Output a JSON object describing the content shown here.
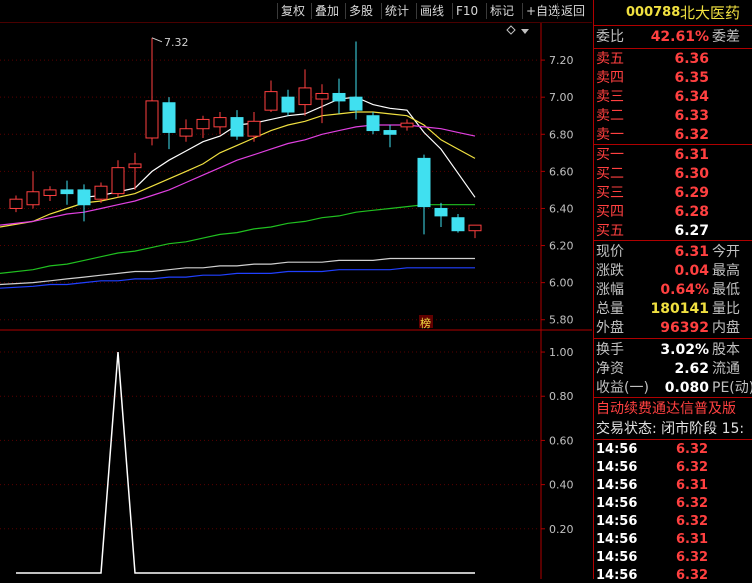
{
  "toolbar": {
    "buttons": [
      "复权",
      "叠加",
      "多股",
      "统计",
      "画线",
      "F10",
      "标记",
      "+自选",
      "返回"
    ]
  },
  "stock": {
    "code": "000788",
    "name": "北大医药"
  },
  "quote": {
    "weibi_label": "委比",
    "weibi_value": "42.61%",
    "weicha_label": "委差",
    "sell": [
      {
        "label": "卖五",
        "price": "6.36"
      },
      {
        "label": "卖四",
        "price": "6.35"
      },
      {
        "label": "卖三",
        "price": "6.34"
      },
      {
        "label": "卖二",
        "price": "6.33"
      },
      {
        "label": "卖一",
        "price": "6.32"
      }
    ],
    "buy": [
      {
        "label": "买一",
        "price": "6.31"
      },
      {
        "label": "买二",
        "price": "6.30"
      },
      {
        "label": "买三",
        "price": "6.29"
      },
      {
        "label": "买四",
        "price": "6.28"
      },
      {
        "label": "买五",
        "price": "6.27"
      }
    ],
    "stats": [
      {
        "label": "现价",
        "value": "6.31",
        "label2": "今开",
        "color": "red"
      },
      {
        "label": "涨跌",
        "value": "0.04",
        "label2": "最高",
        "color": "red"
      },
      {
        "label": "涨幅",
        "value": "0.64%",
        "label2": "最低",
        "color": "red"
      },
      {
        "label": "总量",
        "value": "180141",
        "label2": "量比",
        "color": "yellow"
      },
      {
        "label": "外盘",
        "value": "96392",
        "label2": "内盘",
        "color": "red"
      }
    ],
    "stats2": [
      {
        "label": "换手",
        "value": "3.02%",
        "label2": "股本",
        "color": "white"
      },
      {
        "label": "净资",
        "value": "2.62",
        "label2": "流通",
        "color": "white"
      },
      {
        "label": "收益(一)",
        "value": "0.080",
        "label2": "PE(动)",
        "color": "white"
      }
    ],
    "notice": "自动续费通达信普及版",
    "trade_status": "交易状态: 闭市阶段 15:",
    "ticks": [
      {
        "time": "14:56",
        "price": "6.32"
      },
      {
        "time": "14:56",
        "price": "6.32"
      },
      {
        "time": "14:56",
        "price": "6.31"
      },
      {
        "time": "14:56",
        "price": "6.32"
      },
      {
        "time": "14:56",
        "price": "6.32"
      },
      {
        "time": "14:56",
        "price": "6.31"
      },
      {
        "time": "14:56",
        "price": "6.32"
      },
      {
        "time": "14:56",
        "price": "6.32"
      }
    ]
  },
  "chart_data": [
    {
      "type": "candlestick",
      "y_ticks": [
        "7.20",
        "7.00",
        "6.80",
        "6.60",
        "6.40",
        "6.20",
        "6.00",
        "5.80"
      ],
      "ylim": [
        5.75,
        7.4
      ],
      "high_marker": "7.32",
      "bang_label": "榜",
      "candles": [
        {
          "o": 6.4,
          "c": 6.45,
          "h": 6.47,
          "l": 6.38
        },
        {
          "o": 6.42,
          "c": 6.49,
          "h": 6.6,
          "l": 6.4
        },
        {
          "o": 6.47,
          "c": 6.5,
          "h": 6.52,
          "l": 6.44
        },
        {
          "o": 6.5,
          "c": 6.48,
          "h": 6.55,
          "l": 6.42
        },
        {
          "o": 6.5,
          "c": 6.42,
          "h": 6.53,
          "l": 6.33
        },
        {
          "o": 6.45,
          "c": 6.52,
          "h": 6.54,
          "l": 6.43
        },
        {
          "o": 6.48,
          "c": 6.62,
          "h": 6.66,
          "l": 6.46
        },
        {
          "o": 6.62,
          "c": 6.64,
          "h": 6.7,
          "l": 6.5
        },
        {
          "o": 6.78,
          "c": 6.98,
          "h": 7.32,
          "l": 6.74
        },
        {
          "o": 6.97,
          "c": 6.81,
          "h": 7.0,
          "l": 6.72
        },
        {
          "o": 6.79,
          "c": 6.83,
          "h": 6.88,
          "l": 6.76
        },
        {
          "o": 6.83,
          "c": 6.88,
          "h": 6.9,
          "l": 6.78
        },
        {
          "o": 6.84,
          "c": 6.89,
          "h": 6.92,
          "l": 6.8
        },
        {
          "o": 6.89,
          "c": 6.79,
          "h": 6.93,
          "l": 6.77
        },
        {
          "o": 6.79,
          "c": 6.87,
          "h": 6.92,
          "l": 6.76
        },
        {
          "o": 6.93,
          "c": 7.03,
          "h": 7.09,
          "l": 6.92
        },
        {
          "o": 7.0,
          "c": 6.92,
          "h": 7.04,
          "l": 6.9
        },
        {
          "o": 6.96,
          "c": 7.05,
          "h": 7.15,
          "l": 6.9
        },
        {
          "o": 6.99,
          "c": 7.02,
          "h": 7.07,
          "l": 6.86
        },
        {
          "o": 7.02,
          "c": 6.98,
          "h": 7.1,
          "l": 6.91
        },
        {
          "o": 7.0,
          "c": 6.93,
          "h": 7.3,
          "l": 6.88
        },
        {
          "o": 6.9,
          "c": 6.82,
          "h": 6.92,
          "l": 6.8
        },
        {
          "o": 6.82,
          "c": 6.8,
          "h": 6.85,
          "l": 6.73
        },
        {
          "o": 6.84,
          "c": 6.86,
          "h": 6.88,
          "l": 6.82
        },
        {
          "o": 6.67,
          "c": 6.41,
          "h": 6.69,
          "l": 6.26
        },
        {
          "o": 6.4,
          "c": 6.36,
          "h": 6.43,
          "l": 6.3
        },
        {
          "o": 6.35,
          "c": 6.28,
          "h": 6.37,
          "l": 6.27
        },
        {
          "o": 6.28,
          "c": 6.31,
          "h": 6.31,
          "l": 6.24
        }
      ],
      "ma_lines": [
        {
          "color": "#ffffff",
          "values": [
            null,
            null,
            null,
            null,
            6.46,
            6.47,
            6.49,
            6.51,
            6.6,
            6.66,
            6.71,
            6.76,
            6.79,
            6.85,
            6.86,
            6.88,
            6.9,
            6.91,
            6.95,
            6.99,
            7.0,
            6.96,
            6.94,
            6.93,
            6.81,
            6.72,
            6.59,
            6.46
          ]
        },
        {
          "color": "#f0e040",
          "values": [
            6.3,
            6.33,
            6.37,
            6.4,
            6.43,
            6.44,
            6.46,
            6.48,
            6.52,
            6.56,
            6.6,
            6.64,
            6.7,
            6.74,
            6.78,
            6.82,
            6.85,
            6.87,
            6.9,
            6.91,
            6.92,
            6.92,
            6.91,
            6.9,
            6.85,
            6.77,
            6.72,
            6.67
          ]
        },
        {
          "color": "#e040e0",
          "values": [
            6.31,
            6.33,
            6.35,
            6.37,
            6.38,
            6.4,
            6.42,
            6.44,
            6.47,
            6.5,
            6.54,
            6.58,
            6.62,
            6.66,
            6.69,
            6.72,
            6.75,
            6.77,
            6.8,
            6.82,
            6.84,
            6.85,
            6.85,
            6.85,
            6.84,
            6.83,
            6.81,
            6.79
          ]
        },
        {
          "color": "#20c020",
          "values": [
            6.05,
            6.07,
            6.09,
            6.1,
            6.12,
            6.14,
            6.16,
            6.17,
            6.19,
            6.21,
            6.22,
            6.24,
            6.26,
            6.27,
            6.29,
            6.3,
            6.32,
            6.33,
            6.35,
            6.36,
            6.38,
            6.39,
            6.4,
            6.41,
            6.42,
            6.42,
            6.42,
            6.42
          ]
        },
        {
          "color": "#d0d0d0",
          "values": [
            5.99,
            6.0,
            6.01,
            6.02,
            6.03,
            6.04,
            6.05,
            6.06,
            6.06,
            6.07,
            6.08,
            6.08,
            6.09,
            6.09,
            6.1,
            6.1,
            6.11,
            6.11,
            6.11,
            6.12,
            6.12,
            6.12,
            6.13,
            6.13,
            6.13,
            6.13,
            6.13,
            6.13
          ]
        },
        {
          "color": "#2040ff",
          "values": [
            5.97,
            5.98,
            5.99,
            5.99,
            6.0,
            6.01,
            6.01,
            6.02,
            6.02,
            6.03,
            6.03,
            6.04,
            6.04,
            6.05,
            6.05,
            6.05,
            6.06,
            6.06,
            6.06,
            6.07,
            6.07,
            6.07,
            6.07,
            6.08,
            6.08,
            6.08,
            6.08,
            6.08
          ]
        }
      ]
    },
    {
      "type": "line",
      "y_ticks": [
        "1.00",
        "0.80",
        "0.60",
        "0.40",
        "0.20"
      ],
      "ylim": [
        0,
        1.05
      ],
      "series": [
        {
          "color": "#ffffff",
          "values": [
            0,
            0,
            0,
            0,
            0,
            0,
            1,
            0,
            0,
            0,
            0,
            0,
            0,
            0,
            0,
            0,
            0,
            0,
            0,
            0,
            0,
            0,
            0,
            0,
            0,
            0,
            0,
            0
          ]
        }
      ]
    }
  ]
}
